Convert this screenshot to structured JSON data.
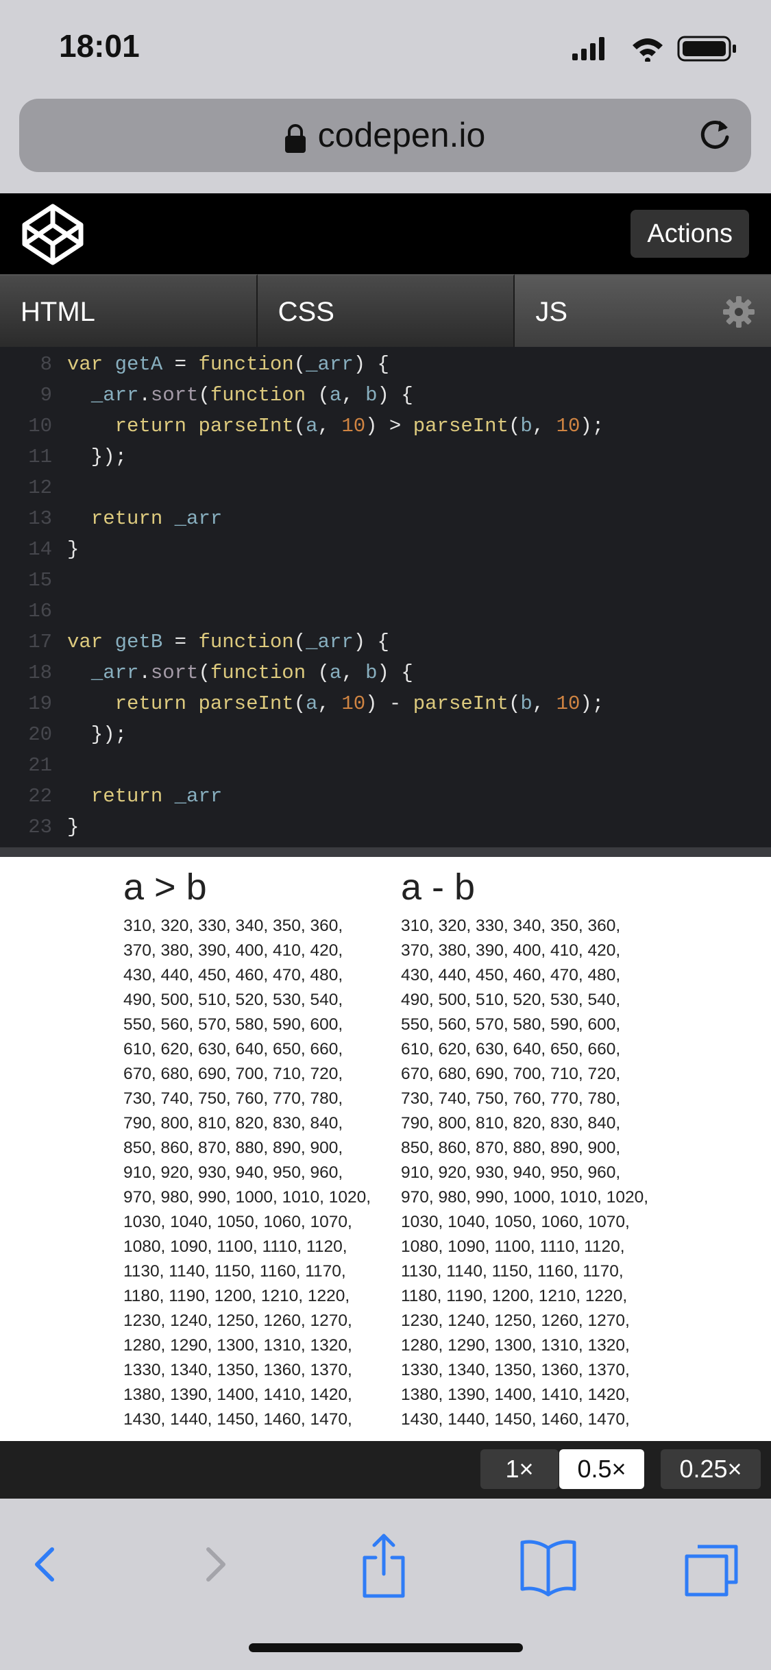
{
  "status_bar": {
    "time": "18:01"
  },
  "browser": {
    "url": "codepen.io"
  },
  "codepen": {
    "actions_label": "Actions"
  },
  "tabs": [
    {
      "label": "HTML"
    },
    {
      "label": "CSS"
    },
    {
      "label": "JS"
    }
  ],
  "code": {
    "line_numbers": [
      "8",
      "9",
      "10",
      "11",
      "12",
      "13",
      "14",
      "15",
      "16",
      "17",
      "18",
      "19",
      "20",
      "21",
      "22",
      "23"
    ],
    "lines": [
      [
        [
          "kw",
          "var"
        ],
        [
          "plain",
          " "
        ],
        [
          "var",
          "getA"
        ],
        [
          "plain",
          " = "
        ],
        [
          "kw",
          "function"
        ],
        [
          "plain",
          "("
        ],
        [
          "var",
          "_arr"
        ],
        [
          "plain",
          ") {"
        ]
      ],
      [
        [
          "plain",
          "  "
        ],
        [
          "var",
          "_arr"
        ],
        [
          "plain",
          "."
        ],
        [
          "prop",
          "sort"
        ],
        [
          "plain",
          "("
        ],
        [
          "kw",
          "function"
        ],
        [
          "plain",
          " ("
        ],
        [
          "var",
          "a"
        ],
        [
          "plain",
          ", "
        ],
        [
          "var",
          "b"
        ],
        [
          "plain",
          ") {"
        ]
      ],
      [
        [
          "plain",
          "    "
        ],
        [
          "kw",
          "return"
        ],
        [
          "plain",
          " "
        ],
        [
          "kw",
          "parseInt"
        ],
        [
          "plain",
          "("
        ],
        [
          "var",
          "a"
        ],
        [
          "plain",
          ", "
        ],
        [
          "num",
          "10"
        ],
        [
          "plain",
          ") > "
        ],
        [
          "kw",
          "parseInt"
        ],
        [
          "plain",
          "("
        ],
        [
          "var",
          "b"
        ],
        [
          "plain",
          ", "
        ],
        [
          "num",
          "10"
        ],
        [
          "plain",
          ");"
        ]
      ],
      [
        [
          "plain",
          "  });"
        ]
      ],
      [],
      [
        [
          "plain",
          "  "
        ],
        [
          "kw",
          "return"
        ],
        [
          "plain",
          " "
        ],
        [
          "var",
          "_arr"
        ]
      ],
      [
        [
          "plain",
          "}"
        ]
      ],
      [],
      [],
      [
        [
          "kw",
          "var"
        ],
        [
          "plain",
          " "
        ],
        [
          "var",
          "getB"
        ],
        [
          "plain",
          " = "
        ],
        [
          "kw",
          "function"
        ],
        [
          "plain",
          "("
        ],
        [
          "var",
          "_arr"
        ],
        [
          "plain",
          ") {"
        ]
      ],
      [
        [
          "plain",
          "  "
        ],
        [
          "var",
          "_arr"
        ],
        [
          "plain",
          "."
        ],
        [
          "prop",
          "sort"
        ],
        [
          "plain",
          "("
        ],
        [
          "kw",
          "function"
        ],
        [
          "plain",
          " ("
        ],
        [
          "var",
          "a"
        ],
        [
          "plain",
          ", "
        ],
        [
          "var",
          "b"
        ],
        [
          "plain",
          ") {"
        ]
      ],
      [
        [
          "plain",
          "    "
        ],
        [
          "kw",
          "return"
        ],
        [
          "plain",
          " "
        ],
        [
          "kw",
          "parseInt"
        ],
        [
          "plain",
          "("
        ],
        [
          "var",
          "a"
        ],
        [
          "plain",
          ", "
        ],
        [
          "num",
          "10"
        ],
        [
          "plain",
          ") - "
        ],
        [
          "kw",
          "parseInt"
        ],
        [
          "plain",
          "("
        ],
        [
          "var",
          "b"
        ],
        [
          "plain",
          ", "
        ],
        [
          "num",
          "10"
        ],
        [
          "plain",
          ");"
        ]
      ],
      [
        [
          "plain",
          "  });"
        ]
      ],
      [],
      [
        [
          "plain",
          "  "
        ],
        [
          "kw",
          "return"
        ],
        [
          "plain",
          " "
        ],
        [
          "var",
          "_arr"
        ]
      ],
      [
        [
          "plain",
          "}"
        ]
      ]
    ]
  },
  "result": {
    "col_a": {
      "heading": "a > b",
      "text": "310, 320, 330, 340, 350, 360, 370, 380, 390, 400, 410, 420, 430, 440, 450, 460, 470, 480, 490, 500, 510, 520, 530, 540, 550, 560, 570, 580, 590, 600, 610, 620, 630, 640, 650, 660, 670, 680, 690, 700, 710, 720, 730, 740, 750, 760, 770, 780, 790, 800, 810, 820, 830, 840, 850, 860, 870, 880, 890, 900, 910, 920, 930, 940, 950, 960, 970, 980, 990, 1000, 1010, 1020, 1030, 1040, 1050, 1060, 1070, 1080, 1090, 1100, 1110, 1120, 1130, 1140, 1150, 1160, 1170, 1180, 1190, 1200, 1210, 1220, 1230, 1240, 1250, 1260, 1270, 1280, 1290, 1300, 1310, 1320, 1330, 1340, 1350, 1360, 1370, 1380, 1390, 1400, 1410, 1420, 1430, 1440, 1450, 1460, 1470,"
    },
    "col_b": {
      "heading": "a - b",
      "text": "310, 320, 330, 340, 350, 360, 370, 380, 390, 400, 410, 420, 430, 440, 450, 460, 470, 480, 490, 500, 510, 520, 530, 540, 550, 560, 570, 580, 590, 600, 610, 620, 630, 640, 650, 660, 670, 680, 690, 700, 710, 720, 730, 740, 750, 760, 770, 780, 790, 800, 810, 820, 830, 840, 850, 860, 870, 880, 890, 900, 910, 920, 930, 940, 950, 960, 970, 980, 990, 1000, 1010, 1020, 1030, 1040, 1050, 1060, 1070, 1080, 1090, 1100, 1110, 1120, 1130, 1140, 1150, 1160, 1170, 1180, 1190, 1200, 1210, 1220, 1230, 1240, 1250, 1260, 1270, 1280, 1290, 1300, 1310, 1320, 1330, 1340, 1350, 1360, 1370, 1380, 1390, 1400, 1410, 1420, 1430, 1440, 1450, 1460, 1470,"
    }
  },
  "zoom": {
    "options": [
      "1×",
      "0.5×",
      "0.25×"
    ],
    "selected": "0.5×"
  },
  "toolbar": {
    "icons": [
      "back-icon",
      "forward-icon",
      "share-icon",
      "bookmarks-icon",
      "tabs-icon"
    ],
    "accent_color": "#2f7cf6"
  }
}
